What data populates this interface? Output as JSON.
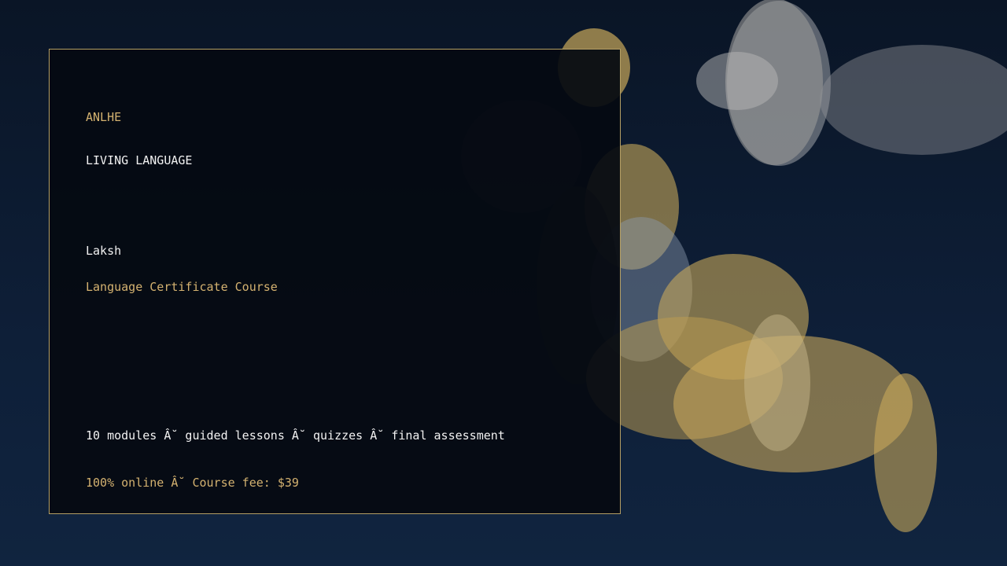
{
  "card": {
    "brand": "ANLHE",
    "program_line": "LIVING LANGUAGE",
    "recipient_name": "Laksh",
    "course_title": "Language Certificate Course",
    "course_details": "10 modules Â˘ guided lessons Â˘ quizzes Â˘ final assessment",
    "pricing_line": "100% online Â˘ Course fee: $39"
  },
  "colors": {
    "accent_gold": "#d4b270",
    "border_gold": "#b59f64",
    "card_background": "#05080f",
    "page_background": "#0e1f38"
  }
}
